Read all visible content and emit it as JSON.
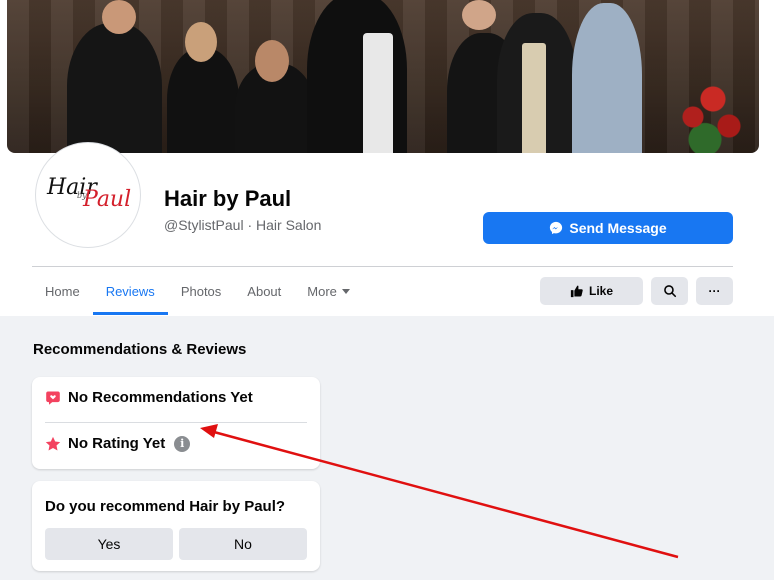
{
  "page": {
    "name": "Hair by Paul",
    "handle_category": "@StylistPaul · Hair Salon",
    "logo": {
      "word1": "Hair",
      "word2": "Paul",
      "word3": "by"
    }
  },
  "header": {
    "send_message_label": "Send Message"
  },
  "tabs": [
    {
      "label": "Home"
    },
    {
      "label": "Reviews",
      "active": true
    },
    {
      "label": "Photos"
    },
    {
      "label": "About"
    },
    {
      "label": "More"
    }
  ],
  "actions": {
    "like_label": "Like",
    "more_label": "···"
  },
  "reviews": {
    "section_title": "Recommendations & Reviews",
    "no_recommendations": "No Recommendations Yet",
    "no_rating": "No Rating Yet",
    "info_glyph": "i"
  },
  "recommend": {
    "question": "Do you recommend Hair by Paul?",
    "yes_label": "Yes",
    "no_label": "No"
  },
  "colors": {
    "accent": "#1877f2",
    "annotation_arrow": "#e01010",
    "recommend_icon": "#f3425f"
  }
}
